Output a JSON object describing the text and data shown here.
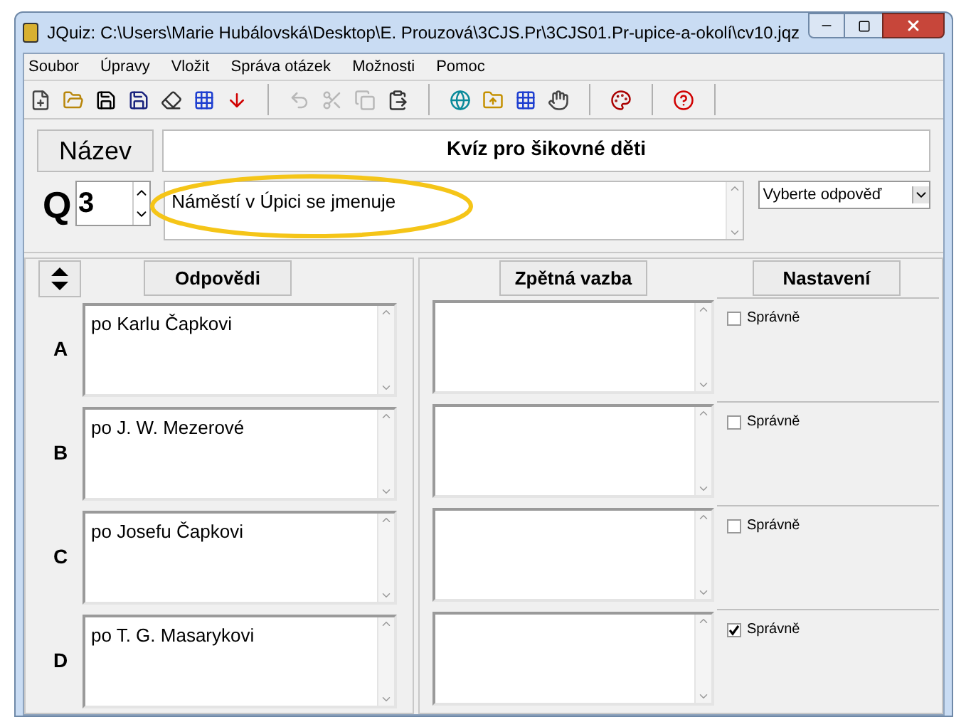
{
  "window": {
    "title": "JQuiz: C:\\Users\\Marie Hubálovská\\Desktop\\E. Prouzová\\3CJS.Pr\\3CJS01.Pr-upice-a-okolí\\cv10.jqz"
  },
  "menu": [
    "Soubor",
    "Úpravy",
    "Vložit",
    "Správa otázek",
    "Možnosti",
    "Pomoc"
  ],
  "toolbar_groups": [
    [
      {
        "kind": "new",
        "disabled": false
      },
      {
        "kind": "open",
        "disabled": false
      },
      {
        "kind": "save",
        "disabled": false
      },
      {
        "kind": "save-as",
        "disabled": false
      },
      {
        "kind": "eraser",
        "disabled": false
      },
      {
        "kind": "grid",
        "disabled": false
      },
      {
        "kind": "down",
        "disabled": false
      }
    ],
    [
      {
        "kind": "undo",
        "disabled": true
      },
      {
        "kind": "cut",
        "disabled": true
      },
      {
        "kind": "copy",
        "disabled": true
      },
      {
        "kind": "paste",
        "disabled": false
      }
    ],
    [
      {
        "kind": "web",
        "disabled": false
      },
      {
        "kind": "folder-web",
        "disabled": false
      },
      {
        "kind": "grid",
        "disabled": false
      },
      {
        "kind": "hand",
        "disabled": false
      }
    ],
    [
      {
        "kind": "palette",
        "disabled": false
      }
    ],
    [
      {
        "kind": "help",
        "disabled": false
      }
    ]
  ],
  "title_button": "Název",
  "quiz_title": "Kvíz pro šikovné děti",
  "question": {
    "label": "Q",
    "number": "3",
    "text": "Náměstí v Úpici se jmenuje",
    "highlighted": true
  },
  "answer_type": "Vyberte odpověď",
  "headers": {
    "answers": "Odpovědi",
    "feedback": "Zpětná vazba",
    "settings": "Nastavení"
  },
  "answers": [
    {
      "letter": "A",
      "text": "po Karlu Čapkovi",
      "correct_label": "Správně",
      "checked": false
    },
    {
      "letter": "B",
      "text": "po J. W. Mezerové",
      "correct_label": "Správně",
      "checked": false
    },
    {
      "letter": "C",
      "text": "po Josefu Čapkovi",
      "correct_label": "Správně",
      "checked": false
    },
    {
      "letter": "D",
      "text": "po T. G. Masarykovi",
      "correct_label": "Správně",
      "checked": true
    }
  ]
}
